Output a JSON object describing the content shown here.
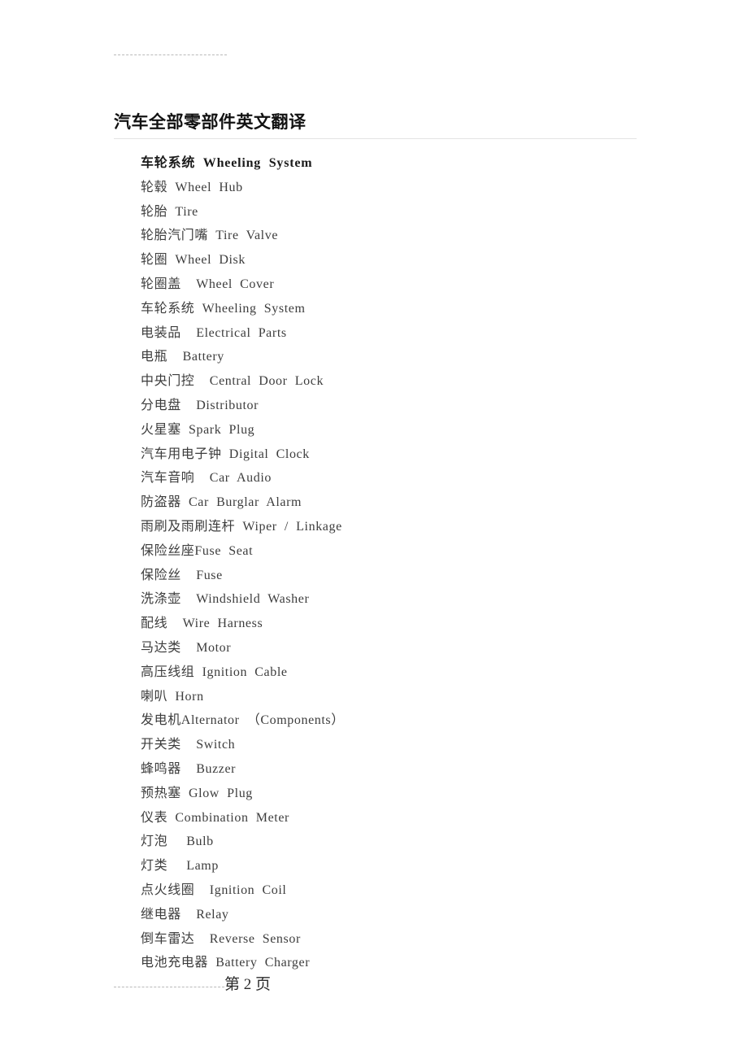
{
  "document": {
    "title": "汽车全部零部件英文翻译",
    "top_divider": "dashed-rule",
    "title_divider": "solid-rule"
  },
  "terms": [
    {
      "text": "车轮系统  Wheeling  System",
      "bold": true
    },
    {
      "text": "轮毂  Wheel  Hub",
      "bold": false
    },
    {
      "text": "轮胎  Tire",
      "bold": false
    },
    {
      "text": "轮胎汽门嘴  Tire  Valve",
      "bold": false
    },
    {
      "text": "轮圈  Wheel  Disk",
      "bold": false
    },
    {
      "text": "轮圈盖    Wheel  Cover",
      "bold": false
    },
    {
      "text": "车轮系统  Wheeling  System",
      "bold": false
    },
    {
      "text": "电装品    Electrical  Parts",
      "bold": false
    },
    {
      "text": "电瓶    Battery",
      "bold": false
    },
    {
      "text": "中央门控    Central  Door  Lock",
      "bold": false
    },
    {
      "text": "分电盘    Distributor",
      "bold": false
    },
    {
      "text": "火星塞  Spark  Plug",
      "bold": false
    },
    {
      "text": "汽车用电子钟  Digital  Clock",
      "bold": false
    },
    {
      "text": "汽车音响    Car  Audio",
      "bold": false
    },
    {
      "text": "防盗器  Car  Burglar  Alarm",
      "bold": false
    },
    {
      "text": "雨刷及雨刷连杆  Wiper  /  Linkage",
      "bold": false
    },
    {
      "text": "保险丝座Fuse  Seat",
      "bold": false
    },
    {
      "text": "保险丝    Fuse",
      "bold": false
    },
    {
      "text": "洗涤壶    Windshield  Washer",
      "bold": false
    },
    {
      "text": "配线    Wire  Harness",
      "bold": false
    },
    {
      "text": "马达类    Motor",
      "bold": false
    },
    {
      "text": "高压线组  Ignition  Cable",
      "bold": false
    },
    {
      "text": "喇叭  Horn",
      "bold": false
    },
    {
      "text": "发电机Alternator  （Components）",
      "bold": false
    },
    {
      "text": "开关类    Switch",
      "bold": false
    },
    {
      "text": "蜂鸣器    Buzzer",
      "bold": false
    },
    {
      "text": "预热塞  Glow  Plug",
      "bold": false
    },
    {
      "text": "仪表  Combination  Meter",
      "bold": false
    },
    {
      "text": "灯泡     Bulb",
      "bold": false
    },
    {
      "text": "灯类     Lamp",
      "bold": false
    },
    {
      "text": "点火线圈    Ignition  Coil",
      "bold": false
    },
    {
      "text": "继电器    Relay",
      "bold": false
    },
    {
      "text": "倒车雷达    Reverse  Sensor",
      "bold": false
    },
    {
      "text": "电池充电器  Battery  Charger",
      "bold": false
    }
  ],
  "footer": {
    "page_label": "第 2 页"
  }
}
